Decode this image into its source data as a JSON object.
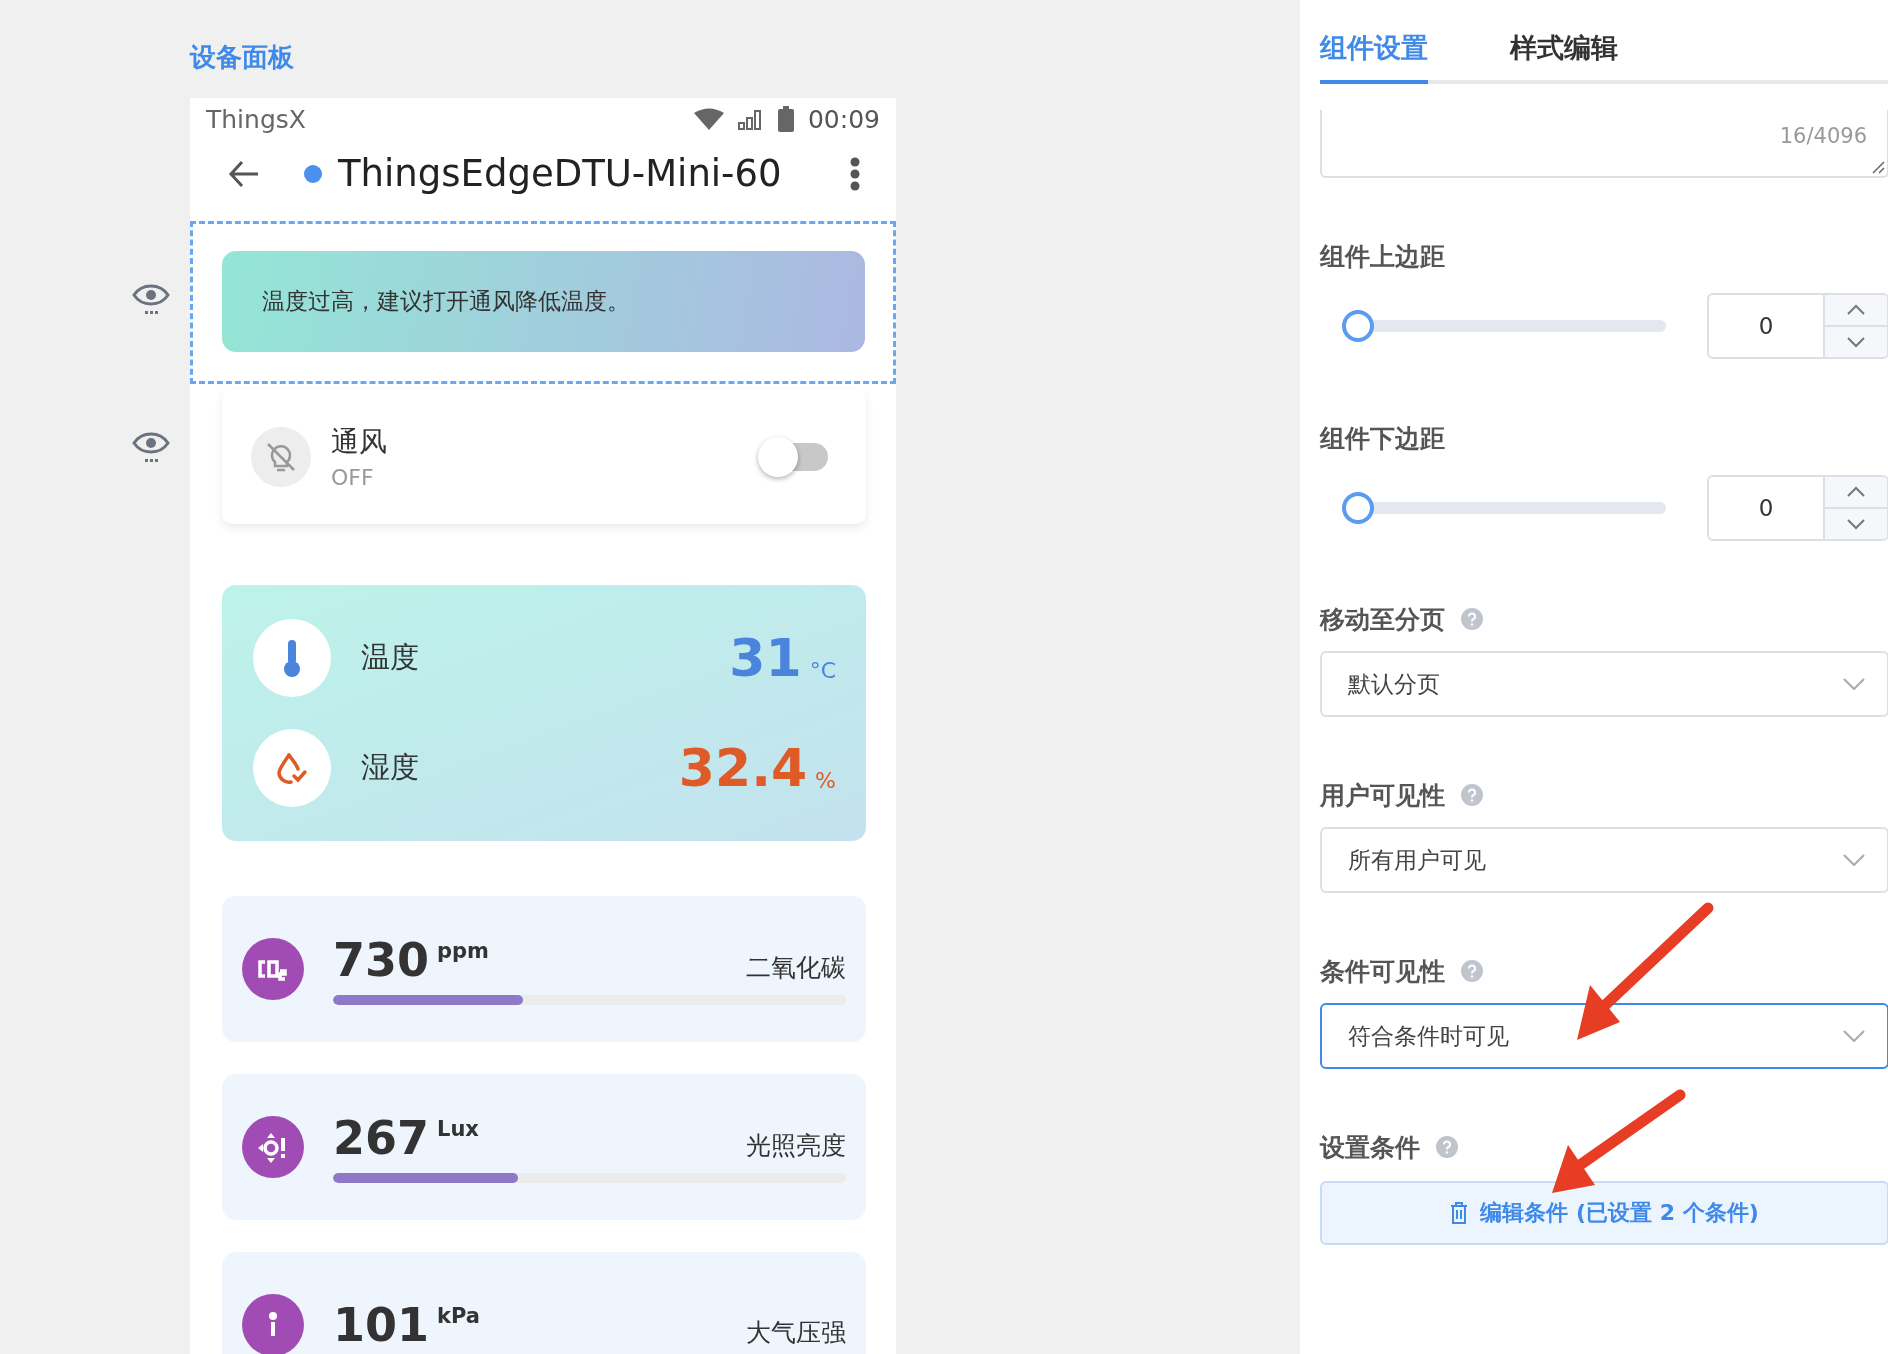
{
  "page_title": "设备面板",
  "phone": {
    "status_bar": {
      "carrier": "ThingsX",
      "time": "00:09"
    },
    "header": {
      "device": "ThingsEdgeDTU-Mini-60",
      "online": true
    },
    "alert": {
      "text": "温度过高，建议打开通风降低温度。",
      "selected": true
    },
    "switch_card": {
      "name": "通风",
      "state": "OFF",
      "on": false
    },
    "sensor_card": {
      "rows": [
        {
          "kind": "temperature",
          "label": "温度",
          "value": "31",
          "unit": "°C",
          "color": "#4a84dc"
        },
        {
          "kind": "humidity",
          "label": "湿度",
          "value": "32.4",
          "unit": "%",
          "color": "#de5a26"
        }
      ]
    },
    "meters": [
      {
        "kind": "co2",
        "value": "730",
        "unit": "ppm",
        "label": "二氧化碳",
        "level": 0.37
      },
      {
        "kind": "light",
        "value": "267",
        "unit": "Lux",
        "label": "光照亮度",
        "level": 0.36
      },
      {
        "kind": "pressure",
        "value": "101",
        "unit": "kPa",
        "label": "大气压强"
      }
    ]
  },
  "panel": {
    "tabs": [
      {
        "label": "组件设置",
        "selected": true
      },
      {
        "label": "样式编辑",
        "selected": false
      }
    ],
    "textarea": {
      "counter": "16/4096"
    },
    "margins": [
      {
        "label": "组件上边距",
        "level": 0,
        "value": "0"
      },
      {
        "label": "组件下边距",
        "level": 0,
        "value": "0"
      }
    ],
    "selects": [
      {
        "label": "移动至分页",
        "value": "默认分页",
        "focused": false
      },
      {
        "label": "用户可见性",
        "value": "所有用户可见",
        "focused": false
      },
      {
        "label": "条件可见性",
        "value": "符合条件时可见",
        "focused": true
      }
    ],
    "conditions": {
      "label": "设置条件",
      "button": "编辑条件 (已设置 2 个条件)"
    }
  }
}
